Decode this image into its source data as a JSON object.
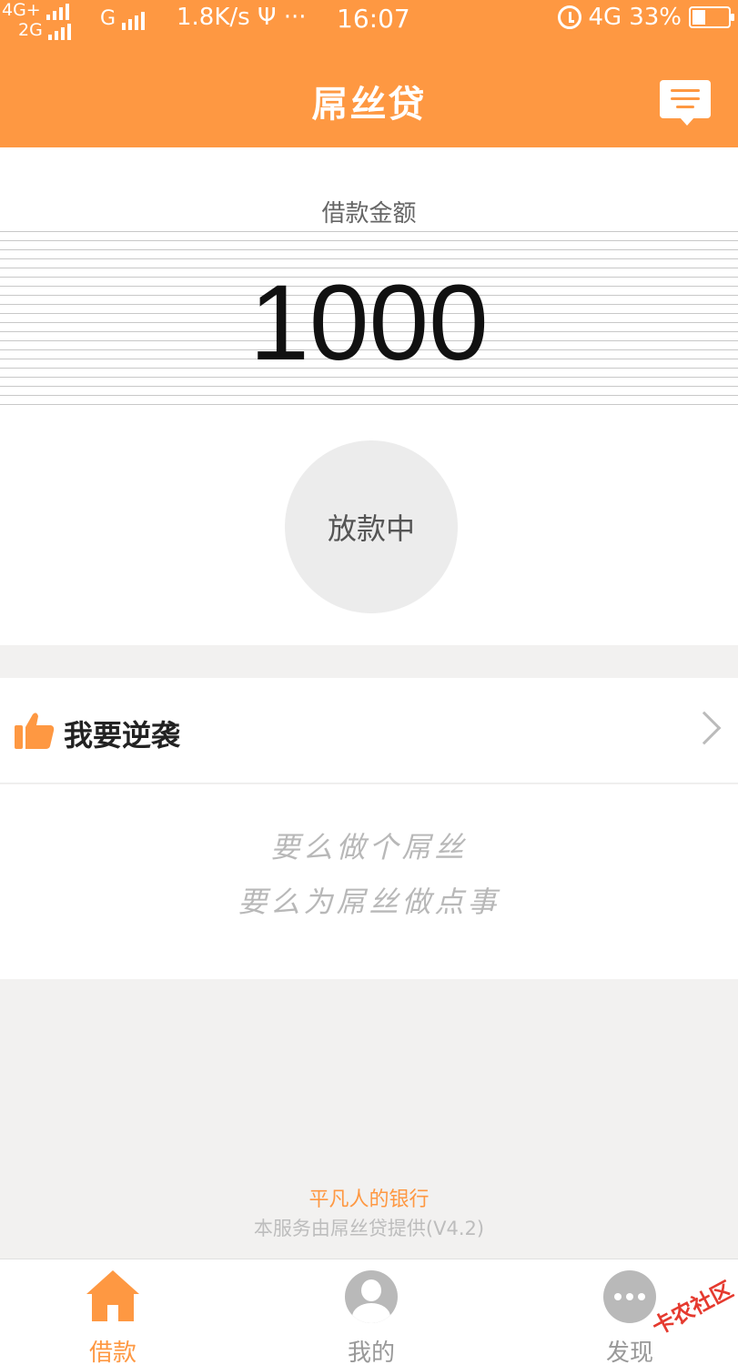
{
  "status_bar": {
    "net1": "4G+",
    "net2": "2G",
    "net3": "G",
    "speed": "1.8K/s",
    "usb": "Ψ",
    "dots": "···",
    "time": "16:07",
    "net4": "4G",
    "battery": "33%"
  },
  "header": {
    "title": "屌丝贷",
    "icon": "message-icon"
  },
  "loan": {
    "label": "借款金额",
    "amount": "1000",
    "status": "放款中"
  },
  "nixi": {
    "label": "我要逆袭",
    "icon": "thumbs-up-icon"
  },
  "slogan": {
    "line1": "要么做个屌丝",
    "line2": "要么为屌丝做点事"
  },
  "footer": {
    "tagline": "平凡人的银行",
    "note": "本服务由屌丝贷提供(V4.2)"
  },
  "tabs": [
    {
      "label": "借款",
      "icon": "home-icon",
      "active": true
    },
    {
      "label": "我的",
      "icon": "user-icon",
      "active": false
    },
    {
      "label": "发现",
      "icon": "more-icon",
      "active": false
    }
  ],
  "watermark": "卡农社区",
  "colors": {
    "accent": "#fe9842",
    "background": "#f2f1f0"
  }
}
